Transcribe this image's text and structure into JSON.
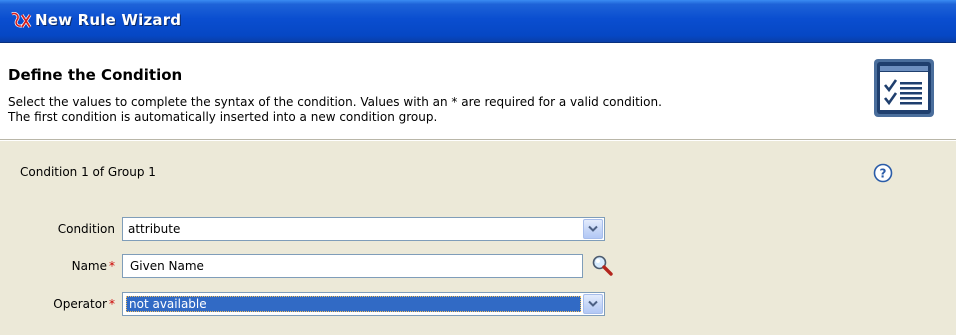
{
  "window": {
    "title": "New Rule Wizard"
  },
  "header": {
    "title": "Define the Condition",
    "description_line1": "Select the values to complete the syntax of the condition.  Values with an * are required for a valid condition.",
    "description_line2": "The first condition is automatically inserted into a new condition group."
  },
  "panel": {
    "group_label": "Condition 1 of Group 1",
    "required_marker": "*",
    "condition": {
      "label": "Condition",
      "value": "attribute"
    },
    "name": {
      "label": "Name",
      "value": "Given Name"
    },
    "operator": {
      "label": "Operator",
      "value": "not available"
    }
  },
  "icons": {
    "title_icon": "wizard-rule-icon",
    "header_icon": "checklist-icon",
    "help_icon": "help-icon",
    "browse_icon": "magnifier-icon",
    "dropdown_icon": "chevron-down-icon"
  },
  "colors": {
    "titlebar": "#0a4ed0",
    "panel_bg": "#ece9d8",
    "required": "#cc0000",
    "selection": "#316ac5"
  }
}
